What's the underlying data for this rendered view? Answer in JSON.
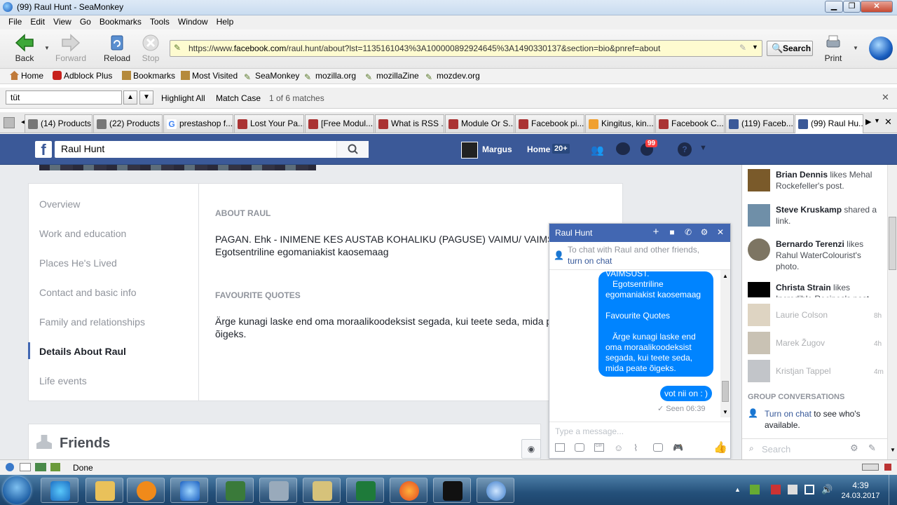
{
  "window": {
    "title": "(99) Raul Hunt - SeaMonkey"
  },
  "menu": [
    "File",
    "Edit",
    "View",
    "Go",
    "Bookmarks",
    "Tools",
    "Window",
    "Help"
  ],
  "nav": {
    "back": "Back",
    "forward": "Forward",
    "reload": "Reload",
    "stop": "Stop",
    "print": "Print",
    "search": "Search",
    "url_prefix": "https://www.",
    "url_domain": "facebook.com",
    "url_rest": "/raul.hunt/about?lst=1135161043%3A100000892924645%3A1490330137&section=bio&pnref=about"
  },
  "bookmarks": [
    "Home",
    "Adblock Plus",
    "Bookmarks",
    "Most Visited",
    "SeaMonkey",
    "mozilla.org",
    "mozillaZine",
    "mozdev.org"
  ],
  "find": {
    "value": "tüt",
    "highlight": "Highlight All",
    "match_case": "Match Case",
    "status": "1 of 6 matches"
  },
  "tabs": [
    "(14) Products",
    "(22) Products",
    "prestashop f...",
    "Lost Your Pa...",
    "[Free Modul...",
    "What is RSS ...",
    "Module Or S...",
    "Facebook pi...",
    "Kingitus, kin...",
    "Facebook C...",
    "(119) Faceb...",
    "(99) Raul Hu..."
  ],
  "fb": {
    "search_value": "Raul Hunt",
    "user": "Margus",
    "home": "Home",
    "home_count": "20+",
    "notif_count": "99",
    "about_nav": [
      "Overview",
      "Work and education",
      "Places He's Lived",
      "Contact and basic info",
      "Family and relationships",
      "Details About Raul",
      "Life events"
    ],
    "about_heading": "ABOUT RAUL",
    "about_text": "PAGAN. Ehk - INIMENE KES AUSTAB KOHALIKU (PAGUSE) VAIMU/ VAIMSUST.",
    "about_text2": "Egotsentriline egomaniakist kaosemaag",
    "quotes_heading": "FAVOURITE QUOTES",
    "quotes_text": "Ärge kunagi laske end oma moraalikoodeksist segada, kui teete seda, mida peate",
    "quotes_text2": "õigeks.",
    "friends": "Friends"
  },
  "chat": {
    "title": "Raul Hunt",
    "notice": "To chat with Raul and other friends,",
    "notice_link": "turn on chat",
    "bubble_lines": [
      "VAIMSUST.",
      "   Egotsentriline",
      "egomaniakist kaosemaag",
      "",
      "Favourite Quotes",
      "",
      "   Ärge kunagi laske end",
      "oma moraalikoodeksist",
      "segada, kui teete seda,",
      "mida peate õigeks."
    ],
    "reply": "vot nii on : )",
    "seen": "Seen 06:39",
    "placeholder": "Type a message..."
  },
  "ticker": [
    {
      "name": "Brian Dennis",
      "text": " likes Mehal Rockefeller's post."
    },
    {
      "name": "Steve Kruskamp",
      "text": " shared a link."
    },
    {
      "name": "Bernardo Terenzi",
      "text": " likes Rahul WaterColourist's photo."
    },
    {
      "name": "Christa Strain",
      "text": " likes Incredible Recipes's post."
    }
  ],
  "contacts": [
    {
      "name": "Laurie Colson",
      "time": "8h"
    },
    {
      "name": "Marek Žugov",
      "time": "4h"
    },
    {
      "name": "Kristjan Tappel",
      "time": "4m"
    }
  ],
  "group_conv": "GROUP CONVERSATIONS",
  "turn_on_chat": "Turn on chat",
  "turn_on_rest": " to see who's available.",
  "chat_search": "Search",
  "status": "Done",
  "clock": {
    "time": "4:39",
    "date": "24.03.2017"
  }
}
